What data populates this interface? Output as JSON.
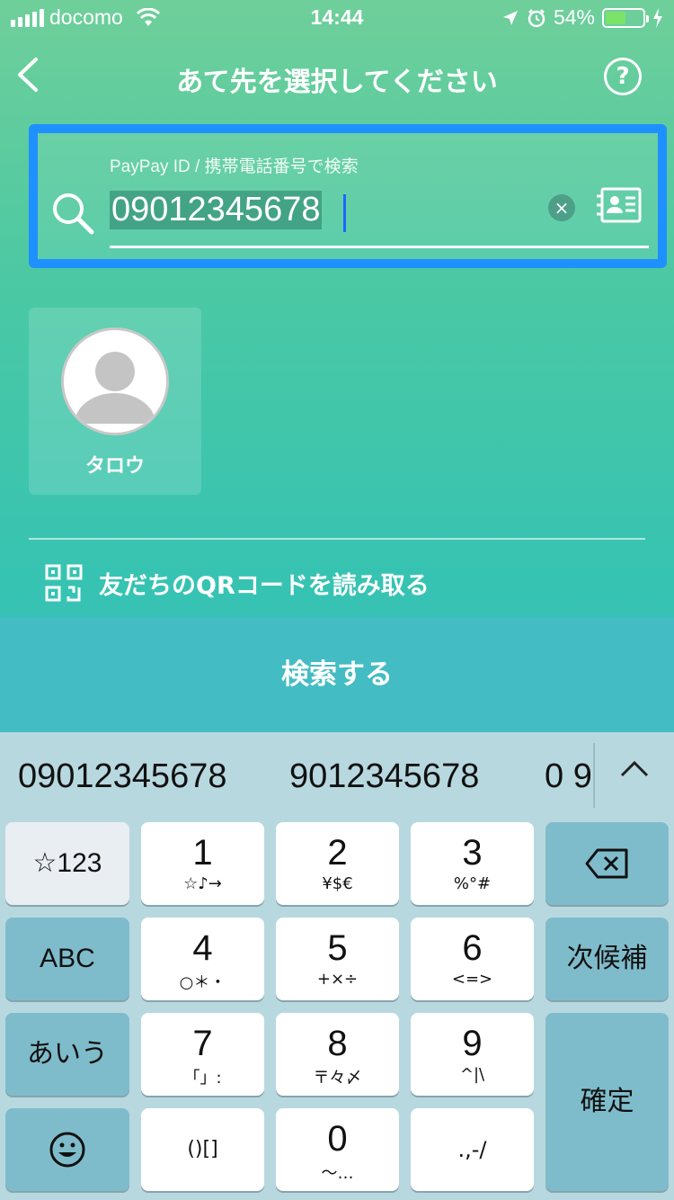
{
  "status_bar": {
    "carrier": "docomo",
    "time": "14:44",
    "battery": "54%",
    "battery_level": 0.54
  },
  "nav": {
    "title": "あて先を選択してください",
    "help": "?"
  },
  "search": {
    "label": "PayPay ID / 携帯電話番号で検索",
    "value": "09012345678",
    "clear": "×"
  },
  "recent": {
    "contact_name": "タロウ"
  },
  "qr": {
    "label": "友だちのQRコードを読み取る"
  },
  "actions": {
    "search_button": "検索する"
  },
  "keyboard": {
    "suggestions": [
      "09012345678",
      "9012345678",
      "0 9"
    ],
    "keys": {
      "symbols": "☆123",
      "abc": "ABC",
      "kana": "あいう",
      "emoji": "☺",
      "k1": "1",
      "k1_sub": "☆♪→",
      "k2": "2",
      "k2_sub": "¥$€",
      "k3": "3",
      "k3_sub": "%°#",
      "k4": "4",
      "k4_sub": "○＊・",
      "k5": "5",
      "k5_sub": "+×÷",
      "k6": "6",
      "k6_sub": "<=>",
      "k7": "7",
      "k7_sub": "「」:",
      "k8": "8",
      "k8_sub": "〒々〆",
      "k9": "9",
      "k9_sub": "^|\\",
      "k0": "0",
      "k0_sub": "〜…",
      "brackets": "()[]",
      "punct": ".,-/",
      "next_candidate": "次候補",
      "confirm": "確定"
    }
  }
}
